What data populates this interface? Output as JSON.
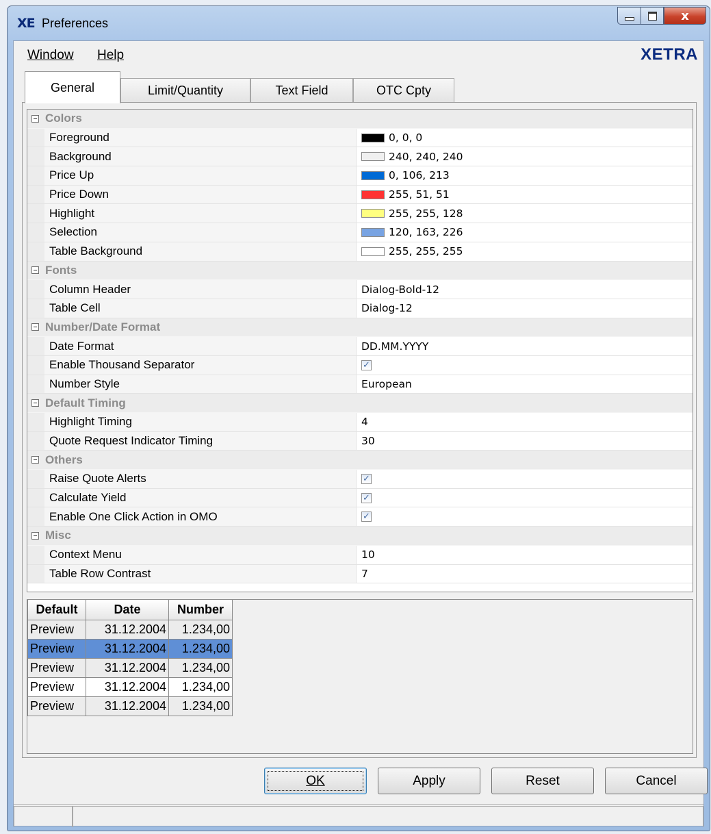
{
  "window": {
    "title": "Preferences",
    "logo": "XE",
    "close_glyph": "x"
  },
  "menu": {
    "window_label": "Window",
    "help_label": "Help",
    "brand": "XETRA"
  },
  "tabs": [
    {
      "label": "General",
      "active": true
    },
    {
      "label": "Limit/Quantity",
      "active": false
    },
    {
      "label": "Text Field",
      "active": false
    },
    {
      "label": "OTC Cpty",
      "active": false
    }
  ],
  "properties": {
    "colors": {
      "title": "Colors",
      "items": [
        {
          "label": "Foreground",
          "value": "0, 0, 0",
          "swatch": "#000000"
        },
        {
          "label": "Background",
          "value": "240, 240, 240",
          "swatch": "#f0f0f0"
        },
        {
          "label": "Price Up",
          "value": "0, 106, 213",
          "swatch": "#006ad5"
        },
        {
          "label": "Price Down",
          "value": "255, 51, 51",
          "swatch": "#ff3333"
        },
        {
          "label": "Highlight",
          "value": "255, 255, 128",
          "swatch": "#ffff80"
        },
        {
          "label": "Selection",
          "value": "120, 163, 226",
          "swatch": "#78a3e2"
        },
        {
          "label": "Table Background",
          "value": "255, 255, 255",
          "swatch": "#ffffff"
        }
      ]
    },
    "fonts": {
      "title": "Fonts",
      "items": [
        {
          "label": "Column Header",
          "value": "Dialog-Bold-12"
        },
        {
          "label": "Table Cell",
          "value": "Dialog-12"
        }
      ]
    },
    "number_date": {
      "title": "Number/Date Format",
      "items": [
        {
          "label": "Date Format",
          "value": "DD.MM.YYYY"
        },
        {
          "label": "Enable Thousand Separator",
          "checked": true
        },
        {
          "label": "Number Style",
          "value": "European"
        }
      ]
    },
    "timing": {
      "title": "Default Timing",
      "items": [
        {
          "label": "Highlight Timing",
          "value": "4"
        },
        {
          "label": "Quote Request Indicator Timing",
          "value": "30"
        }
      ]
    },
    "others": {
      "title": "Others",
      "items": [
        {
          "label": "Raise Quote Alerts",
          "checked": true
        },
        {
          "label": "Calculate Yield",
          "checked": true
        },
        {
          "label": "Enable One Click Action in OMO",
          "checked": true
        }
      ]
    },
    "misc": {
      "title": "Misc",
      "items": [
        {
          "label": "Context Menu",
          "value": "10"
        },
        {
          "label": "Table Row Contrast",
          "value": "7"
        }
      ]
    }
  },
  "check_glyph": "✓",
  "preview": {
    "headers": [
      "Default",
      "Date",
      "Number"
    ],
    "rows": [
      [
        "Preview",
        "31.12.2004",
        "1.234,00"
      ],
      [
        "Preview",
        "31.12.2004",
        "1.234,00"
      ],
      [
        "Preview",
        "31.12.2004",
        "1.234,00"
      ],
      [
        "Preview",
        "31.12.2004",
        "1.234,00"
      ],
      [
        "Preview",
        "31.12.2004",
        "1.234,00"
      ]
    ],
    "selected_row": 1
  },
  "buttons": {
    "ok": "OK",
    "apply": "Apply",
    "reset": "Reset",
    "cancel": "Cancel"
  }
}
